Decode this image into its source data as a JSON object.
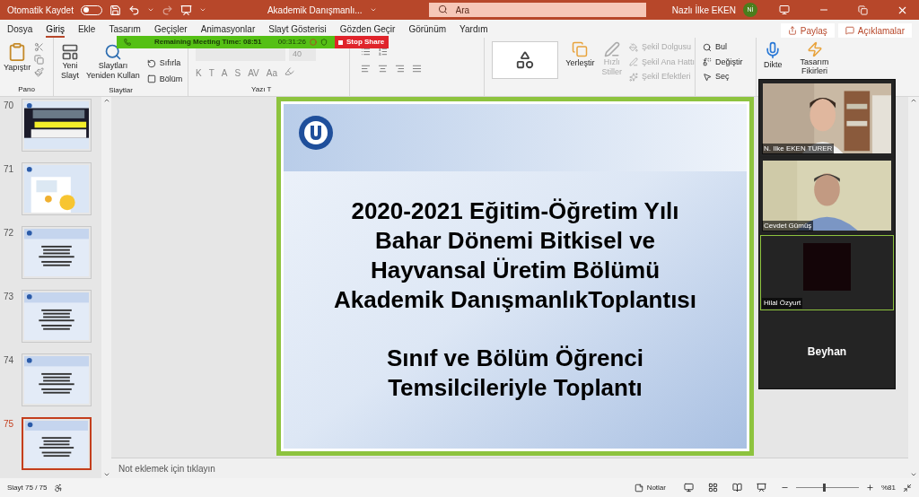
{
  "title_bar": {
    "autosave_label": "Otomatik Kaydet",
    "autosave_on": false,
    "document": "Akademik Danışmanlı...",
    "search_placeholder": "Ara",
    "user": "Nazlı İlke EKEN",
    "avatar": "Nİ"
  },
  "tabs": [
    {
      "label": "Dosya",
      "selected": false
    },
    {
      "label": "Giriş",
      "selected": true
    },
    {
      "label": "Ekle",
      "selected": false
    },
    {
      "label": "Tasarım",
      "selected": false
    },
    {
      "label": "Geçişler",
      "selected": false
    },
    {
      "label": "Animasyonlar",
      "selected": false
    },
    {
      "label": "Slayt Gösterisi",
      "selected": false
    },
    {
      "label": "Gözden Geçir",
      "selected": false
    },
    {
      "label": "Görünüm",
      "selected": false
    },
    {
      "label": "Yardım",
      "selected": false
    }
  ],
  "share_button": "Paylaş",
  "comments_button": "Açıklamalar",
  "meeting_bar": {
    "remaining": "Remaining Meeting Time: 08:51",
    "elapsed": "00:31:26",
    "stop": "Stop Share"
  },
  "ribbon": {
    "pano": {
      "label": "Pano",
      "paste": "Yapıştır"
    },
    "slaytlar": {
      "label": "Slaytlar",
      "new_slide": [
        "Yeni",
        "Slayt"
      ],
      "reuse": [
        "Slaytları",
        "Yeniden Kullan"
      ],
      "small": [
        "Sıfırla",
        "Bölüm"
      ]
    },
    "font": {
      "label": "Yazı T",
      "size": "40",
      "buttons": [
        "K",
        "T",
        "A",
        "S",
        "AV",
        "Aa"
      ]
    },
    "drawing": {
      "arrange": "Yerleştir",
      "quick_styles": [
        "Hızlı",
        "Stiller"
      ],
      "shape": [
        "Şekil Dolgusu",
        "Şekil Ana Hattı",
        "Şekil Efektleri"
      ]
    },
    "editing": [
      "Bul",
      "Değiştir",
      "Seç"
    ],
    "voice": "Dikte",
    "designer": [
      "Tasarım",
      "Fikirleri"
    ]
  },
  "thumbnails": [
    {
      "number": "70",
      "kind": "picture",
      "selected": false
    },
    {
      "number": "71",
      "kind": "picture",
      "selected": false
    },
    {
      "number": "72",
      "kind": "text",
      "selected": false
    },
    {
      "number": "73",
      "kind": "text",
      "selected": false
    },
    {
      "number": "74",
      "kind": "text",
      "selected": false
    },
    {
      "number": "75",
      "kind": "text",
      "selected": true
    }
  ],
  "slide": {
    "title_lines": [
      "2020-2021 Eğitim-Öğretim Yılı",
      "Bahar Dönemi Bitkisel ve",
      "Hayvansal Üretim Bölümü",
      "Akademik DanışmanlıkToplantısı"
    ],
    "subtitle_lines": [
      "Sınıf ve Bölüm Öğrenci",
      "Temsilcileriyle Toplantı"
    ]
  },
  "notes_placeholder": "Not eklemek için tıklayın",
  "participants": [
    {
      "name": "N. Ilke EKEN TURER",
      "kind": "video",
      "speaking": false
    },
    {
      "name": "Cevdet Gümüş",
      "kind": "video",
      "speaking": false
    },
    {
      "name": "Hilal Özyurt",
      "kind": "blank",
      "speaking": true
    },
    {
      "name": "Beyhan",
      "kind": "name",
      "speaking": false
    }
  ],
  "status_bar": {
    "slide": "Slayt 75 / 75",
    "notes": "Notlar",
    "zoom": "%81",
    "level": 0.45
  }
}
